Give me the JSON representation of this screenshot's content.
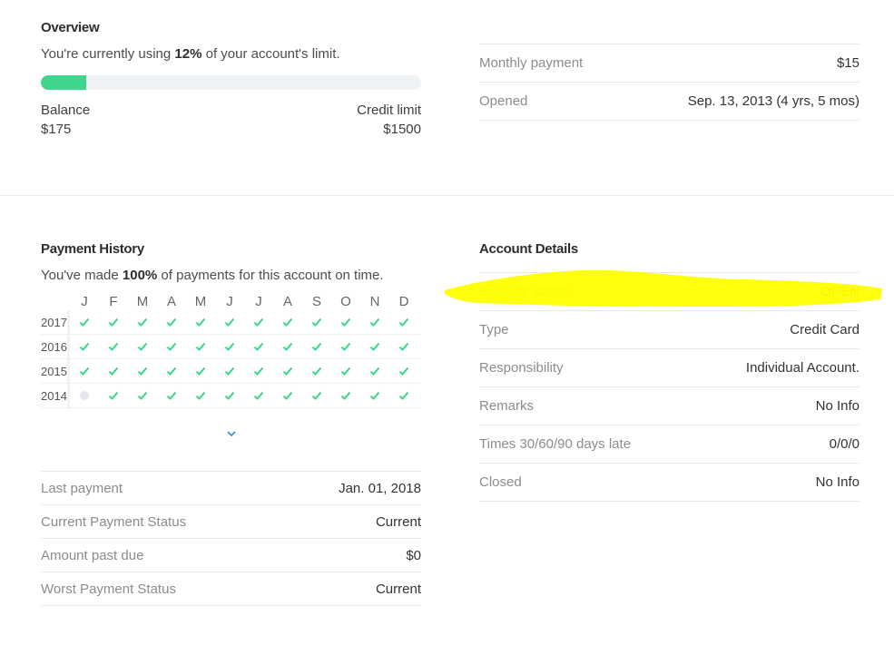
{
  "overview": {
    "title": "Overview",
    "usage_prefix": "You're currently using ",
    "usage_percent_text": "12%",
    "usage_suffix": " of your account's limit.",
    "usage_fraction": 0.12,
    "balance_label": "Balance",
    "balance_value": "$175",
    "limit_label": "Credit limit",
    "limit_value": "$1500",
    "accent_color": "#3dd68c"
  },
  "summary": [
    {
      "label": "Monthly payment",
      "value": "$15"
    },
    {
      "label": "Opened",
      "value": "Sep. 13, 2013 (4 yrs, 5 mos)"
    }
  ],
  "payment_history": {
    "title": "Payment History",
    "ontime_prefix": "You've made ",
    "ontime_percent_text": "100%",
    "ontime_suffix": " of payments for this account on time.",
    "months": [
      "J",
      "F",
      "M",
      "A",
      "M",
      "J",
      "J",
      "A",
      "S",
      "O",
      "N",
      "D"
    ],
    "years": [
      {
        "year": "2017",
        "status": [
          "ok",
          "ok",
          "ok",
          "ok",
          "ok",
          "ok",
          "ok",
          "ok",
          "ok",
          "ok",
          "ok",
          "ok"
        ]
      },
      {
        "year": "2016",
        "status": [
          "ok",
          "ok",
          "ok",
          "ok",
          "ok",
          "ok",
          "ok",
          "ok",
          "ok",
          "ok",
          "ok",
          "ok"
        ]
      },
      {
        "year": "2015",
        "status": [
          "ok",
          "ok",
          "ok",
          "ok",
          "ok",
          "ok",
          "ok",
          "ok",
          "ok",
          "ok",
          "ok",
          "ok"
        ]
      },
      {
        "year": "2014",
        "status": [
          "none",
          "ok",
          "ok",
          "ok",
          "ok",
          "ok",
          "ok",
          "ok",
          "ok",
          "ok",
          "ok",
          "ok"
        ]
      }
    ],
    "expand_icon": "chevron-down-icon",
    "details": [
      {
        "label": "Last payment",
        "value": "Jan. 01, 2018"
      },
      {
        "label": "Current Payment Status",
        "value": "Current"
      },
      {
        "label": "Amount past due",
        "value": "$0"
      },
      {
        "label": "Worst Payment Status",
        "value": "Current"
      }
    ]
  },
  "account_details": {
    "title": "Account Details",
    "rows": [
      {
        "label": "Account status",
        "value": "OPEN"
      },
      {
        "label": "Type",
        "value": "Credit Card"
      },
      {
        "label": "Responsibility",
        "value": "Individual Account."
      },
      {
        "label": "Remarks",
        "value": "No Info"
      },
      {
        "label": "Times 30/60/90 days late",
        "value": "0/0/0"
      },
      {
        "label": "Closed",
        "value": "No Info"
      }
    ],
    "highlight_color": "#ffff00"
  }
}
